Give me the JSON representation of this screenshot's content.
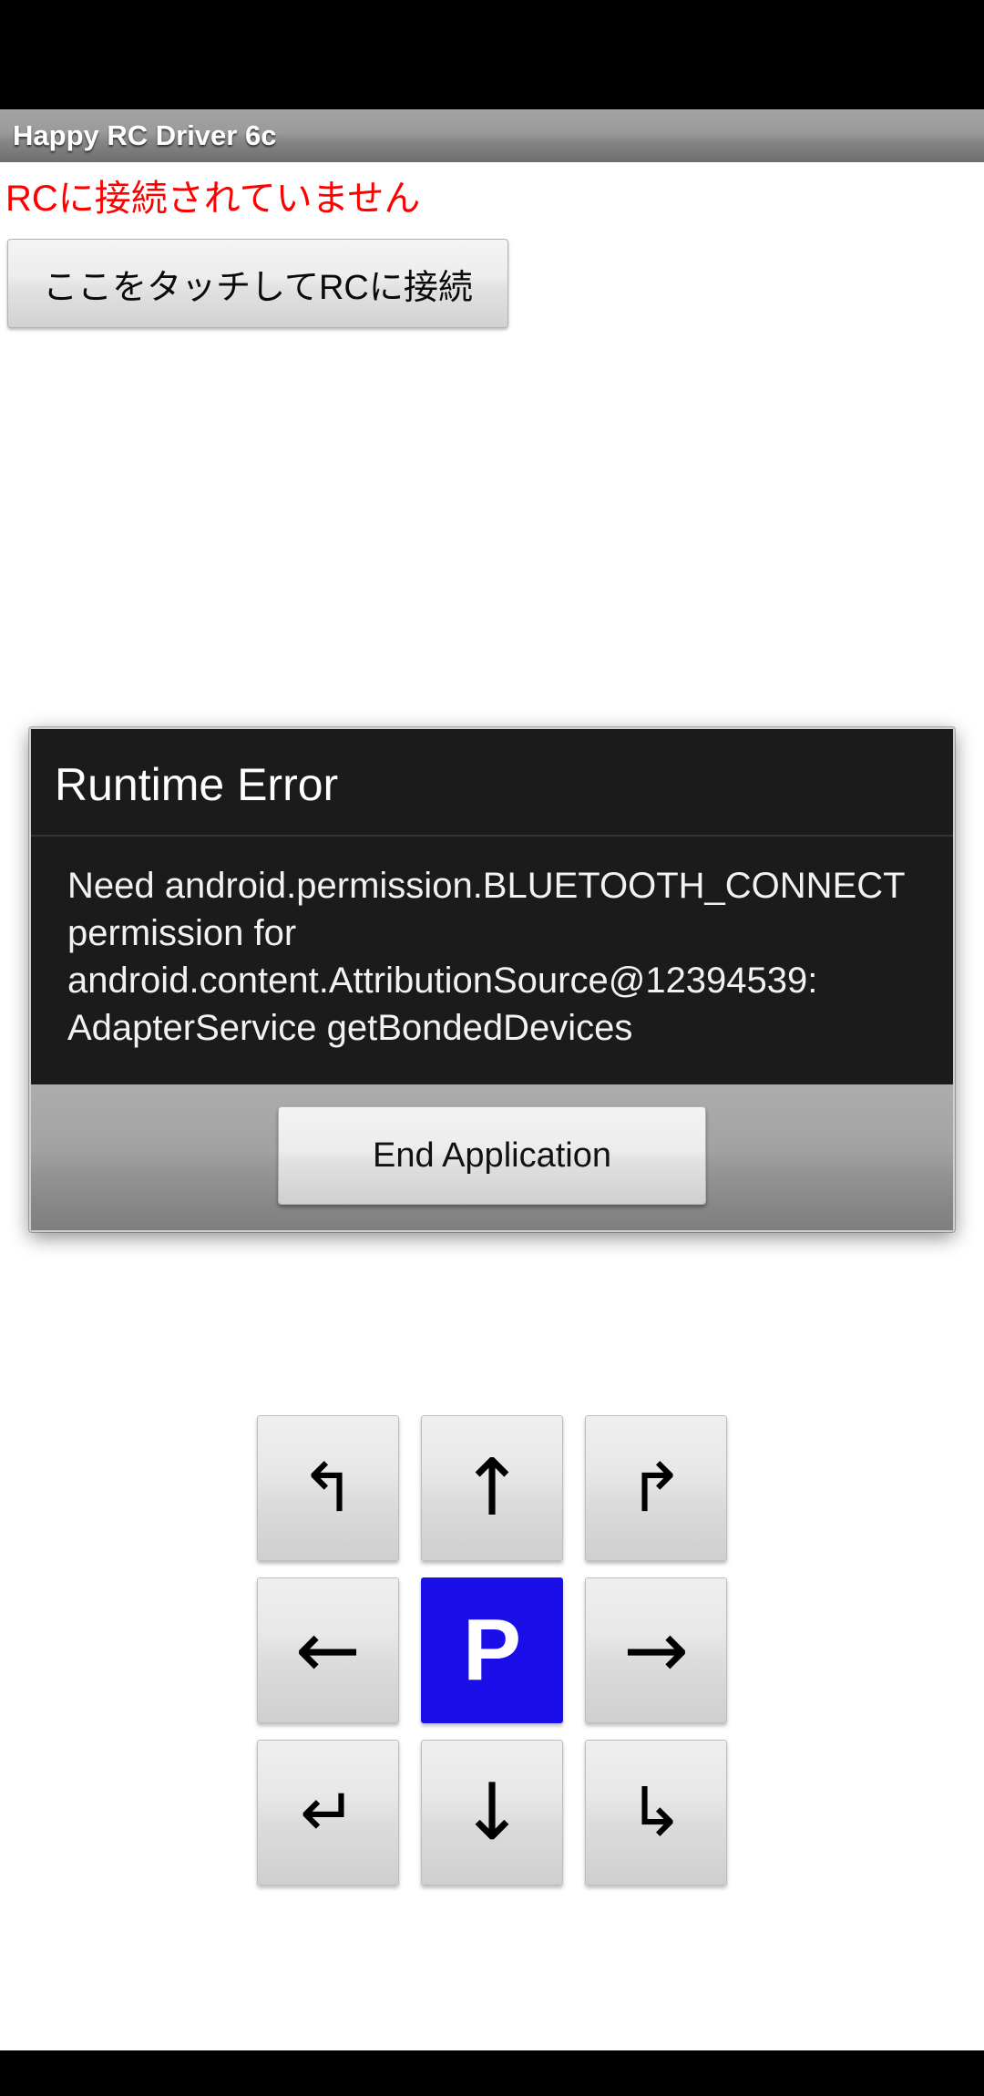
{
  "window": {
    "title": "Happy RC Driver 6c"
  },
  "main": {
    "connection_status": "RCに接続されていません",
    "connect_button_label": "ここをタッチしてRCに接続",
    "status_color": "#ff0000"
  },
  "dialog": {
    "title": "Runtime Error",
    "message": "Need android.permission.BLUETOOTH_CONNECT permission for android.content.AttributionSource@12394539: AdapterService getBondedDevices",
    "action_label": "End Application",
    "background_color": "#1b1b1b",
    "footer_color": "#9a9a9a"
  },
  "dpad": {
    "accent_color": "#1a0fe8",
    "rows": [
      [
        {
          "name": "turn-left-forward",
          "glyph": "↰",
          "size": "small",
          "style": "normal"
        },
        {
          "name": "forward",
          "glyph": "↑",
          "size": "large",
          "style": "normal"
        },
        {
          "name": "turn-right-forward",
          "glyph": "↱",
          "size": "small",
          "style": "normal"
        }
      ],
      [
        {
          "name": "left",
          "glyph": "←",
          "size": "large",
          "style": "normal"
        },
        {
          "name": "park",
          "glyph": "P",
          "size": "large",
          "style": "park"
        },
        {
          "name": "right",
          "glyph": "→",
          "size": "large",
          "style": "normal"
        }
      ],
      [
        {
          "name": "turn-left-backward",
          "glyph": "↵",
          "size": "small",
          "style": "normal"
        },
        {
          "name": "backward",
          "glyph": "↓",
          "size": "large",
          "style": "normal"
        },
        {
          "name": "turn-right-backward",
          "glyph": "↳",
          "size": "small",
          "style": "normal"
        }
      ]
    ]
  }
}
